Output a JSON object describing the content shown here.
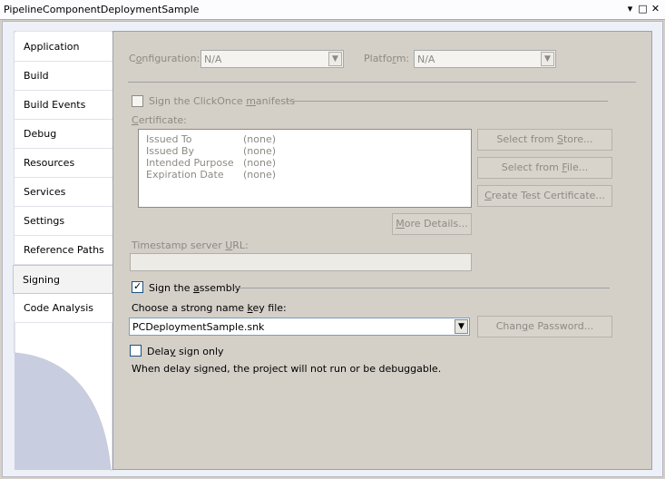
{
  "window": {
    "title": "PipelineComponentDeploymentSample",
    "controls": {
      "dropdown": "▾",
      "restore": "□",
      "close": "✕"
    }
  },
  "tabs": [
    {
      "label": "Application"
    },
    {
      "label": "Build"
    },
    {
      "label": "Build Events"
    },
    {
      "label": "Debug"
    },
    {
      "label": "Resources"
    },
    {
      "label": "Services"
    },
    {
      "label": "Settings"
    },
    {
      "label": "Reference Paths"
    },
    {
      "label": "Signing",
      "active": true
    },
    {
      "label": "Code Analysis"
    }
  ],
  "config": {
    "configuration_label_pre": "C",
    "configuration_label_u": "o",
    "configuration_label_post": "nfiguration:",
    "configuration_value": "N/A",
    "platform_label_pre": "Platfo",
    "platform_label_u": "r",
    "platform_label_post": "m:",
    "platform_value": "N/A"
  },
  "clickonce": {
    "label_pre": "Sign the ClickOnce ",
    "label_u": "m",
    "label_post": "anifests",
    "checked": false
  },
  "certificate": {
    "label_pre": "",
    "label_u": "C",
    "label_post": "ertificate:",
    "rows": [
      {
        "key": "Issued To",
        "value": "(none)"
      },
      {
        "key": "Issued By",
        "value": "(none)"
      },
      {
        "key": "Intended Purpose",
        "value": "(none)"
      },
      {
        "key": "Expiration Date",
        "value": "(none)"
      }
    ],
    "select_store_pre": "Select from ",
    "select_store_u": "S",
    "select_store_post": "tore...",
    "select_file_pre": "Select from ",
    "select_file_u": "F",
    "select_file_post": "ile...",
    "create_test_pre": "",
    "create_test_u": "C",
    "create_test_post": "reate Test Certificate...",
    "more_details_pre": "",
    "more_details_u": "M",
    "more_details_post": "ore Details..."
  },
  "timestamp": {
    "label_pre": "Timestamp server ",
    "label_u": "U",
    "label_post": "RL:",
    "value": ""
  },
  "assembly": {
    "label_pre": "Sign the ",
    "label_u": "a",
    "label_post": "ssembly",
    "checked": true,
    "choose_pre": "Choose a strong name ",
    "choose_u": "k",
    "choose_post": "ey file:",
    "key_file": "PCDeploymentSample.snk",
    "change_pw_pre": "Chan",
    "change_pw_u": "g",
    "change_pw_post": "e Password..."
  },
  "delay": {
    "label_pre": "Dela",
    "label_u": "y",
    "label_post": " sign only",
    "checked": false,
    "note": "When delay signed, the project will not run or be debuggable."
  },
  "colors": {
    "window_bg": "#d4d0c8",
    "tab_bg": "#ffffff",
    "disabled_text": "#8c8a84",
    "frame_bg": "#eef0f7"
  },
  "icons": {
    "dropdown_arrow": "▼"
  }
}
